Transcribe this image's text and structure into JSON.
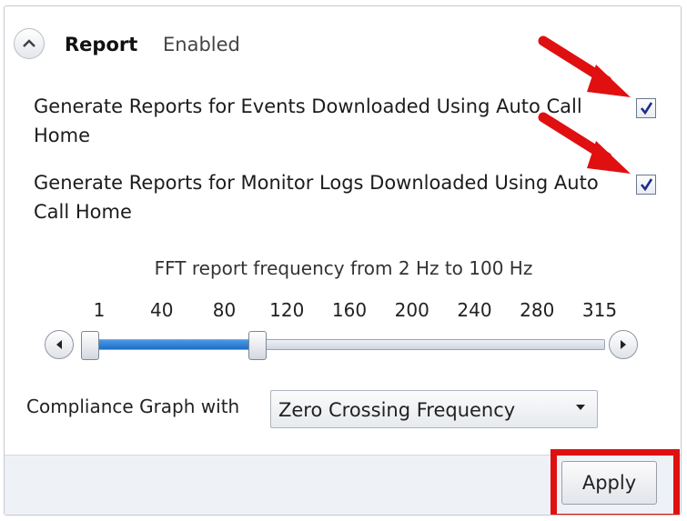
{
  "header": {
    "title": "Report",
    "status": "Enabled"
  },
  "options": [
    {
      "label": "Generate Reports for Events Downloaded Using Auto Call Home",
      "checked": true
    },
    {
      "label": "Generate Reports for Monitor Logs Downloaded Using Auto Call Home",
      "checked": true
    }
  ],
  "fft": {
    "label": "FFT report frequency from 2 Hz to 100 Hz",
    "ticks": [
      "1",
      "40",
      "80",
      "120",
      "160",
      "200",
      "240",
      "280",
      "315"
    ],
    "range_low_fraction": 0.0,
    "range_high_fraction": 0.328
  },
  "compliance": {
    "label": "Compliance Graph with",
    "selected": "Zero Crossing Frequency"
  },
  "footer": {
    "apply_label": "Apply"
  },
  "colors": {
    "annotation": "#e01010",
    "slider_fill": "#2a7fd6"
  },
  "icons": {
    "collapse": "chevron-up-icon",
    "slider_left": "triangle-left-icon",
    "slider_right": "triangle-right-icon",
    "dropdown": "caret-down-icon"
  }
}
